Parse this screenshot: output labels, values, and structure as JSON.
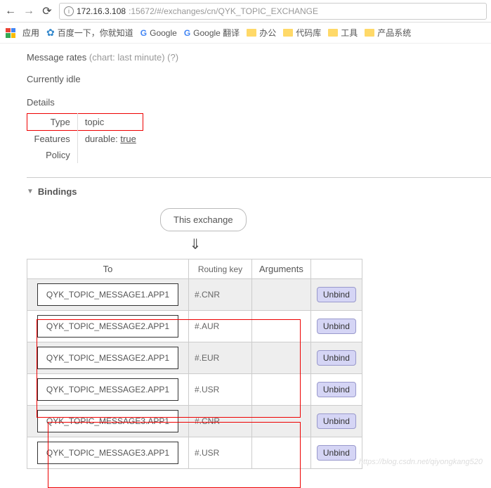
{
  "browser": {
    "url_host": "172.16.3.108",
    "url_path": ":15672/#/exchanges/cn/QYK_TOPIC_EXCHANGE",
    "bookmarks": {
      "apps": "应用",
      "baidu": "百度一下，你就知道",
      "google": "Google",
      "gtranslate": "Google 翻译",
      "folders": [
        "办公",
        "代码库",
        "工具",
        "产品系统"
      ]
    }
  },
  "page": {
    "rates_label": "Message rates",
    "rates_note": "(chart: last minute) (?)",
    "idle": "Currently idle",
    "details_label": "Details",
    "details": {
      "type_label": "Type",
      "type_value": "topic",
      "features_label": "Features",
      "features_value_a": "durable: ",
      "features_value_b": "true",
      "policy_label": "Policy"
    },
    "bindings_label": "Bindings",
    "this_exchange": "This exchange",
    "headers": {
      "to": "To",
      "routing": "Routing key",
      "arguments": "Arguments"
    },
    "unbind": "Unbind",
    "rows": [
      {
        "to": "QYK_TOPIC_MESSAGE1.APP1",
        "routing": "#.CNR"
      },
      {
        "to": "QYK_TOPIC_MESSAGE2.APP1",
        "routing": "#.AUR"
      },
      {
        "to": "QYK_TOPIC_MESSAGE2.APP1",
        "routing": "#.EUR"
      },
      {
        "to": "QYK_TOPIC_MESSAGE2.APP1",
        "routing": "#.USR"
      },
      {
        "to": "QYK_TOPIC_MESSAGE3.APP1",
        "routing": "#.CNR"
      },
      {
        "to": "QYK_TOPIC_MESSAGE3.APP1",
        "routing": "#.USR"
      }
    ],
    "watermark": "https://blog.csdn.net/qiyongkang520"
  }
}
